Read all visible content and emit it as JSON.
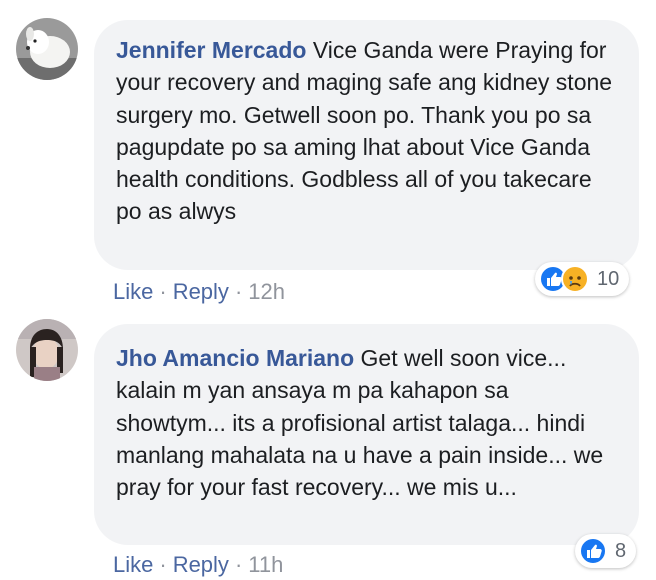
{
  "comments": [
    {
      "author": "Jennifer Mercado",
      "text": "Vice Ganda were Praying for your recovery and maging safe ang kidney stone surgery mo. Getwell soon po. Thank you po sa pagupdate po sa aming lhat about Vice Ganda health conditions. Godbless all of you takecare po as alwys",
      "actions": {
        "like": "Like",
        "reply": "Reply",
        "time": "12h",
        "separator": "·"
      },
      "reactions": {
        "types": [
          "like-icon",
          "sad-icon"
        ],
        "count": "10"
      },
      "colors": {
        "author": "#385898",
        "bubble": "#f2f3f5",
        "like": "#1877f2",
        "sad": "#f7b125"
      }
    },
    {
      "author": "Jho Amancio Mariano",
      "text": "Get well soon vice... kalain m yan ansaya m pa kahapon sa showtym... its a profisional artist talaga... hindi manlang mahalata na u have a pain inside... we pray for your fast recovery... we mis u...",
      "actions": {
        "like": "Like",
        "reply": "Reply",
        "time": "11h",
        "separator": "·"
      },
      "reactions": {
        "types": [
          "like-icon"
        ],
        "count": "8"
      },
      "colors": {
        "author": "#385898",
        "bubble": "#f2f3f5",
        "like": "#1877f2"
      }
    }
  ]
}
